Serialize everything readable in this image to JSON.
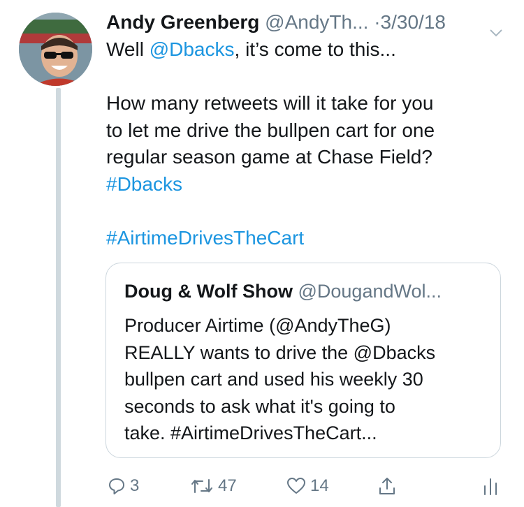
{
  "tweet": {
    "author_name": "Andy Greenberg",
    "author_handle": "@AndyTh...",
    "separator": "·",
    "date": "3/30/18",
    "text_line1_prefix": "Well ",
    "mention_dbacks": "@Dbacks",
    "text_line1_suffix": ", it’s come to this...",
    "text_line2": "How many retweets will it take for you",
    "text_line3": "to let me drive the bullpen cart for one",
    "text_line4": "regular season game at Chase Field?",
    "hashtag1": "#Dbacks",
    "hashtag2": "#AirtimeDrivesTheCart"
  },
  "quoted_tweet": {
    "author_name": "Doug & Wolf Show",
    "author_handle": "@DougandWol...",
    "line1": "Producer Airtime (@AndyTheG)",
    "line2": "REALLY wants to drive the @Dbacks",
    "line3": "bullpen cart and used his weekly 30",
    "line4": "seconds to ask what it's going to",
    "line5": "take. #AirtimeDrivesTheCart..."
  },
  "actions": {
    "reply_count": "3",
    "retweet_count": "47",
    "like_count": "14"
  },
  "icons": {
    "chevron": "chevron-down-icon",
    "reply": "reply-icon",
    "retweet": "retweet-icon",
    "like": "heart-icon",
    "share": "share-icon",
    "analytics": "analytics-icon"
  },
  "colors": {
    "link": "#1b95e0",
    "secondary_text": "#657786",
    "primary_text": "#14171a",
    "border": "#ccd6dd"
  }
}
